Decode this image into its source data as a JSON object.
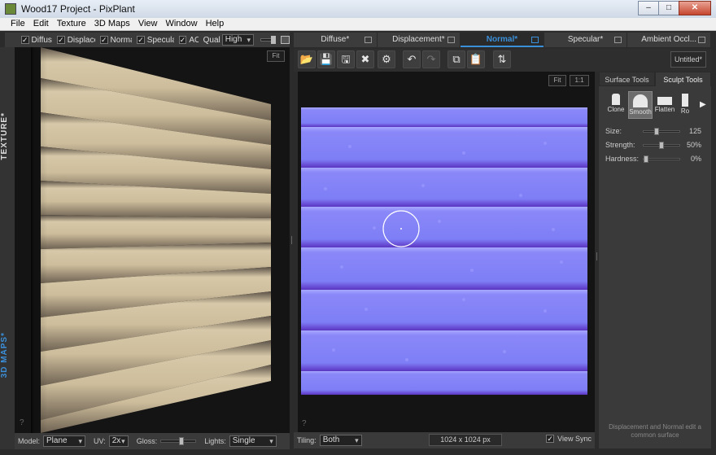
{
  "window": {
    "title": "Wood17 Project - PixPlant",
    "min_label": "–",
    "max_label": "□",
    "close_label": "✕"
  },
  "menu": [
    "File",
    "Edit",
    "Texture",
    "3D Maps",
    "View",
    "Window",
    "Help"
  ],
  "left_toolbar": {
    "checks": [
      {
        "label": "Diffuse",
        "checked": true
      },
      {
        "label": "Displacen",
        "checked": true
      },
      {
        "label": "Normal",
        "checked": true
      },
      {
        "label": "Specular",
        "checked": true
      },
      {
        "label": "AO",
        "checked": true
      }
    ],
    "quality_label": "Qual",
    "quality_value": "High"
  },
  "side_tabs": {
    "texture": "TEXTURE*",
    "maps": "3D MAPS*"
  },
  "left_view": {
    "fit_label": "Fit",
    "help_label": "?"
  },
  "left_bottom": {
    "model_label": "Model:",
    "model_value": "Plane",
    "uv_label": "UV:",
    "uv_value": "2x",
    "gloss_label": "Gloss:",
    "gloss_level": 0.6,
    "lights_label": "Lights:",
    "lights_value": "Single"
  },
  "map_tabs": [
    {
      "label": "Diffuse*",
      "active": false
    },
    {
      "label": "Displacement*",
      "active": false
    },
    {
      "label": "Normal*",
      "active": true
    },
    {
      "label": "Specular*",
      "active": false
    },
    {
      "label": "Ambient Occl...",
      "active": false
    }
  ],
  "toolbar": {
    "buttons": [
      {
        "name": "open-icon",
        "glyph": "📂"
      },
      {
        "name": "save-icon",
        "glyph": "💾"
      },
      {
        "name": "save-as-icon",
        "glyph": "🖫"
      },
      {
        "name": "close-map-icon",
        "glyph": "✖"
      },
      {
        "name": "settings-gear-icon",
        "glyph": "⚙"
      },
      {
        "name": "undo-icon",
        "glyph": "↶"
      },
      {
        "name": "redo-icon",
        "glyph": "↷"
      },
      {
        "name": "copy-icon",
        "glyph": "⧉"
      },
      {
        "name": "paste-icon",
        "glyph": "📋"
      },
      {
        "name": "swap-icon",
        "glyph": "⇅"
      }
    ],
    "untitled_label": "Untitled*"
  },
  "canvas": {
    "fit_label": "Fit",
    "one_to_one_label": "1:1",
    "help_label": "?"
  },
  "canvas_bottom": {
    "tiling_label": "Tiling:",
    "tiling_value": "Both",
    "resolution": "1024 x 1024 px",
    "view_sync_label": "View Sync",
    "view_sync_checked": true
  },
  "tools_panel": {
    "tabs": [
      {
        "label": "Surface Tools",
        "active": false
      },
      {
        "label": "Sculpt Tools",
        "active": true
      }
    ],
    "tools": [
      {
        "label": "Clone",
        "icon": "clone-stamp-icon",
        "active": false
      },
      {
        "label": "Smooth",
        "icon": "smooth-icon",
        "active": true
      },
      {
        "label": "Flatten",
        "icon": "flatten-icon",
        "active": false
      },
      {
        "label": "Ro",
        "icon": "more-tools-arrow-icon",
        "active": false
      }
    ],
    "params": [
      {
        "label": "Size:",
        "value": "125",
        "level": 0.35
      },
      {
        "label": "Strength:",
        "value": "50%",
        "level": 0.5
      },
      {
        "label": "Hardness:",
        "value": "0%",
        "level": 0.0
      }
    ],
    "note": "Displacement and Normal edit a common surface"
  },
  "colors": {
    "accent": "#3b8fd8",
    "normal_map": "#8080f8",
    "wood": "#c9b898"
  }
}
